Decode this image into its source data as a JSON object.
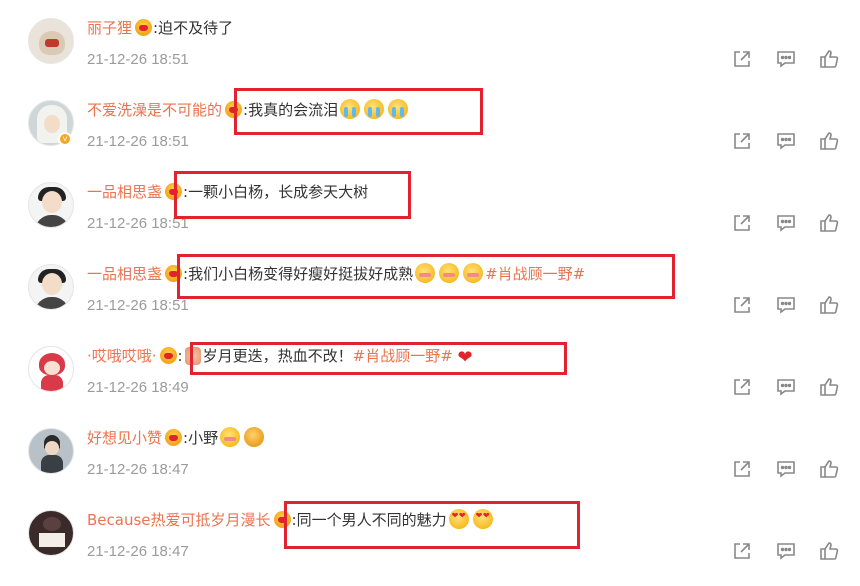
{
  "comments": [
    {
      "username": "丽子狸",
      "text": "迫不及待了",
      "time": "21-12-26 18:51",
      "avatar": "cartoon-avatar"
    },
    {
      "username": "不爱洗澡是不可能的",
      "text": "我真的会流泪",
      "time": "21-12-26 18:51",
      "avatar": "white-hair-avatar",
      "verified": true
    },
    {
      "username": "一品相思盏",
      "text": "一颗小白杨，长成参天大树",
      "time": "21-12-26 18:51",
      "avatar": "man-portrait-avatar"
    },
    {
      "username": "一品相思盏",
      "text": "我们小白杨变得好瘦好挺拔好成熟",
      "hashtag": "#肖战顾一野#",
      "time": "21-12-26 18:51",
      "avatar": "man-portrait-avatar"
    },
    {
      "username": "·哎哦哎哦·",
      "text": "岁月更迭，热血不改！",
      "hashtag": "#肖战顾一野#",
      "time": "21-12-26 18:49",
      "avatar": "red-cartoon-avatar"
    },
    {
      "username": "好想见小赞",
      "text": "小野",
      "time": "21-12-26 18:47",
      "avatar": "man-standing-avatar"
    },
    {
      "username": "Because热爱可抵岁月漫长",
      "text": "同一个男人不同的魅力",
      "time": "21-12-26 18:47",
      "avatar": "photo-avatar"
    }
  ],
  "icons": {
    "share": "share-icon",
    "reply": "comment-icon",
    "like": "thumbs-up-icon"
  },
  "colors": {
    "username": "#eb7350",
    "time": "#9b9b9b",
    "highlight_box": "#e0232e",
    "icon": "#888888"
  }
}
